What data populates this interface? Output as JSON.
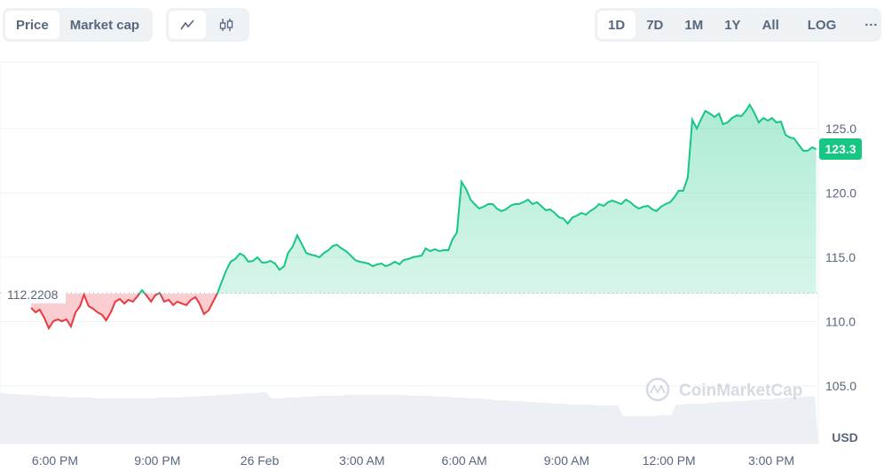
{
  "toolbar": {
    "metric_tabs": [
      {
        "label": "Price",
        "active": true
      },
      {
        "label": "Market cap",
        "active": false
      }
    ],
    "chart_types": [
      {
        "icon": "line-chart-icon",
        "active": true
      },
      {
        "icon": "candlestick-icon",
        "active": false
      }
    ],
    "ranges": [
      "1D",
      "7D",
      "1M",
      "1Y",
      "All"
    ],
    "active_range": "1D",
    "log_label": "LOG",
    "more_label": "···"
  },
  "watermark": "CoinMarketCap",
  "colors": {
    "up": "#16c784",
    "down": "#ea3943",
    "current_badge": "#16c784"
  },
  "chart_data": {
    "type": "line",
    "currency_label": "USD",
    "reference_price_label": "112.2208",
    "reference_price": 112.2208,
    "current_price_label": "123.3",
    "ylim": [
      102,
      130
    ],
    "yticks": [
      105,
      110,
      115,
      120,
      125
    ],
    "ytick_labels": [
      "105.0",
      "110.0",
      "115.0",
      "120.0",
      "125.0"
    ],
    "xtick_labels": [
      "6:00 PM",
      "9:00 PM",
      "26 Feb",
      "3:00 AM",
      "6:00 AM",
      "9:00 AM",
      "12:00 PM",
      "3:00 PM"
    ],
    "xtick_hours": [
      18,
      21,
      24,
      27,
      30,
      33,
      36,
      39
    ],
    "grid": true,
    "volume_shown": true,
    "times": [
      "17:18",
      "17:26",
      "17:33",
      "17:41",
      "17:49",
      "17:57",
      "18:05",
      "18:12",
      "18:20",
      "18:28",
      "18:36",
      "18:44",
      "18:51",
      "18:59",
      "19:07",
      "19:15",
      "19:23",
      "19:30",
      "19:38",
      "19:46",
      "19:54",
      "20:02",
      "20:09",
      "20:17",
      "20:25",
      "20:33",
      "20:41",
      "20:49",
      "20:56",
      "21:04",
      "21:12",
      "21:20",
      "21:28",
      "21:35",
      "21:43",
      "21:51",
      "21:59",
      "22:07",
      "22:14",
      "22:22",
      "22:30",
      "22:38",
      "22:46",
      "22:53",
      "23:01",
      "23:09",
      "23:17",
      "23:25",
      "23:32",
      "23:40",
      "23:48",
      "23:56",
      "00:04",
      "00:11",
      "00:19",
      "00:27",
      "00:35",
      "00:43",
      "00:50",
      "00:58",
      "01:06",
      "01:14",
      "01:22",
      "01:30",
      "01:37",
      "01:45",
      "01:53",
      "02:01",
      "02:09",
      "02:16",
      "02:24",
      "02:32",
      "02:40",
      "02:48",
      "02:55",
      "03:03",
      "03:11",
      "03:19",
      "03:27",
      "03:34",
      "03:42",
      "03:50",
      "03:58",
      "04:06",
      "04:13",
      "04:21",
      "04:29",
      "04:37",
      "04:45",
      "04:52",
      "05:00",
      "05:08",
      "05:16",
      "05:24",
      "05:32",
      "05:39",
      "05:47",
      "05:55",
      "06:03",
      "06:11",
      "06:18",
      "06:26",
      "06:34",
      "06:42",
      "06:50",
      "06:57",
      "07:05",
      "07:13",
      "07:21",
      "07:29",
      "07:36",
      "07:44",
      "07:52",
      "08:00",
      "08:08",
      "08:15",
      "08:23",
      "08:31",
      "08:39",
      "08:47",
      "08:54",
      "09:02",
      "09:10",
      "09:18",
      "09:26",
      "09:34",
      "09:41",
      "09:49",
      "09:57",
      "10:05",
      "10:13",
      "10:20",
      "10:28",
      "10:36",
      "10:44",
      "10:52",
      "10:59",
      "11:07",
      "11:15",
      "11:23",
      "11:31",
      "11:38",
      "11:46",
      "11:54",
      "12:02",
      "12:10",
      "12:17",
      "12:25",
      "12:33",
      "12:41",
      "12:49",
      "12:56",
      "13:04",
      "13:12",
      "13:20",
      "13:28",
      "13:35",
      "13:43",
      "13:51",
      "13:59",
      "14:07",
      "14:15",
      "14:22",
      "14:30",
      "14:38",
      "14:46",
      "14:54",
      "15:01",
      "15:09",
      "15:17",
      "15:25",
      "15:33",
      "15:40",
      "15:48",
      "15:56",
      "16:04",
      "16:12",
      "16:19"
    ],
    "prices": [
      111.07,
      110.72,
      110.93,
      110.31,
      109.48,
      110.03,
      110.17,
      110.03,
      110.17,
      109.62,
      110.72,
      111.21,
      112.1,
      111.21,
      111.0,
      110.72,
      110.52,
      110.1,
      110.72,
      111.55,
      111.76,
      111.41,
      111.69,
      111.55,
      111.97,
      112.45,
      112.03,
      111.55,
      112.03,
      112.24,
      111.55,
      111.69,
      111.28,
      111.55,
      111.41,
      111.28,
      111.69,
      111.9,
      111.41,
      110.59,
      110.86,
      111.55,
      112.24,
      113.07,
      113.97,
      114.66,
      114.86,
      115.28,
      115.14,
      114.66,
      114.72,
      115.0,
      114.59,
      114.59,
      114.72,
      114.52,
      114.03,
      114.31,
      115.34,
      115.83,
      116.72,
      116.03,
      115.34,
      115.21,
      115.14,
      115.0,
      115.34,
      115.55,
      115.9,
      115.97,
      115.69,
      115.48,
      115.14,
      114.79,
      114.66,
      114.59,
      114.52,
      114.31,
      114.45,
      114.52,
      114.31,
      114.45,
      114.66,
      114.45,
      114.79,
      114.86,
      115.0,
      115.07,
      115.14,
      115.69,
      115.48,
      115.62,
      115.48,
      115.55,
      115.55,
      116.38,
      116.93,
      120.86,
      120.31,
      119.48,
      119.14,
      118.79,
      118.93,
      119.14,
      119.14,
      118.79,
      118.59,
      118.72,
      119.0,
      119.14,
      119.14,
      119.28,
      119.48,
      119.14,
      119.28,
      119.0,
      118.66,
      118.72,
      118.45,
      118.1,
      118.03,
      117.62,
      118.1,
      118.24,
      118.45,
      118.31,
      118.59,
      118.79,
      119.14,
      119.0,
      119.28,
      119.41,
      119.28,
      119.14,
      119.48,
      119.28,
      119.0,
      118.79,
      118.93,
      119.0,
      118.72,
      118.59,
      118.93,
      119.14,
      119.28,
      119.69,
      120.17,
      120.17,
      121.21,
      125.69,
      125.0,
      125.69,
      126.38,
      126.17,
      125.9,
      126.17,
      125.34,
      125.48,
      125.83,
      126.03,
      125.97,
      126.38,
      126.86,
      126.24,
      125.48,
      125.83,
      125.62,
      125.83,
      125.48,
      125.55,
      124.52,
      124.31,
      124.24,
      123.76,
      123.28,
      123.28,
      123.55,
      123.41
    ]
  }
}
